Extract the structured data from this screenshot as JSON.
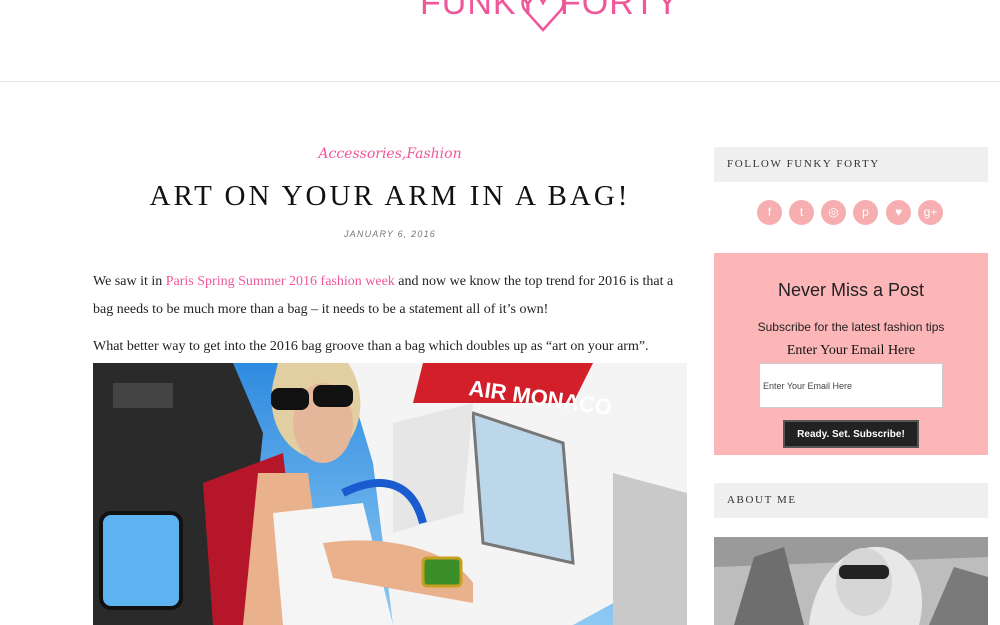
{
  "header": {
    "logo_left": "FUNKY",
    "logo_right": "FORTY"
  },
  "post": {
    "categories": [
      "Accessories",
      "Fashion"
    ],
    "category_separator": ",",
    "title": "ART ON YOUR ARM IN A BAG!",
    "date": "JANUARY 6, 2016",
    "p1_before": "We saw it in ",
    "p1_link": "Paris Spring Summer 2016 fashion week",
    "p1_after": " and now we know the top trend for 2016 is that a bag needs to be much more than a bag – it needs to be a statement all of it’s own!",
    "p2": "What better way to get into the 2016 bag groove than a bag which doubles up as “art on your arm”.",
    "image_caption_text": "AIR MONACO"
  },
  "sidebar": {
    "follow_heading": "FOLLOW FUNKY FORTY",
    "social_icons": [
      {
        "name": "facebook-icon",
        "glyph": "f"
      },
      {
        "name": "twitter-icon",
        "glyph": "t"
      },
      {
        "name": "instagram-icon",
        "glyph": "◎"
      },
      {
        "name": "pinterest-icon",
        "glyph": "p"
      },
      {
        "name": "bloglovin-heart-icon",
        "glyph": "♥"
      },
      {
        "name": "google-plus-icon",
        "glyph": "g+"
      }
    ],
    "subscribe": {
      "title": "Never Miss a Post",
      "description": "Subscribe for the latest fashion tips",
      "label": "Enter Your Email Here",
      "placeholder": "Enter Your Email Here",
      "button": "Ready. Set. Subscribe!"
    },
    "about_heading": "ABOUT ME"
  },
  "colors": {
    "accent_pink": "#f0579a",
    "social_pink": "#f6aeb0",
    "subscribe_bg": "#fdb6b8",
    "widget_bg": "#efefef"
  }
}
